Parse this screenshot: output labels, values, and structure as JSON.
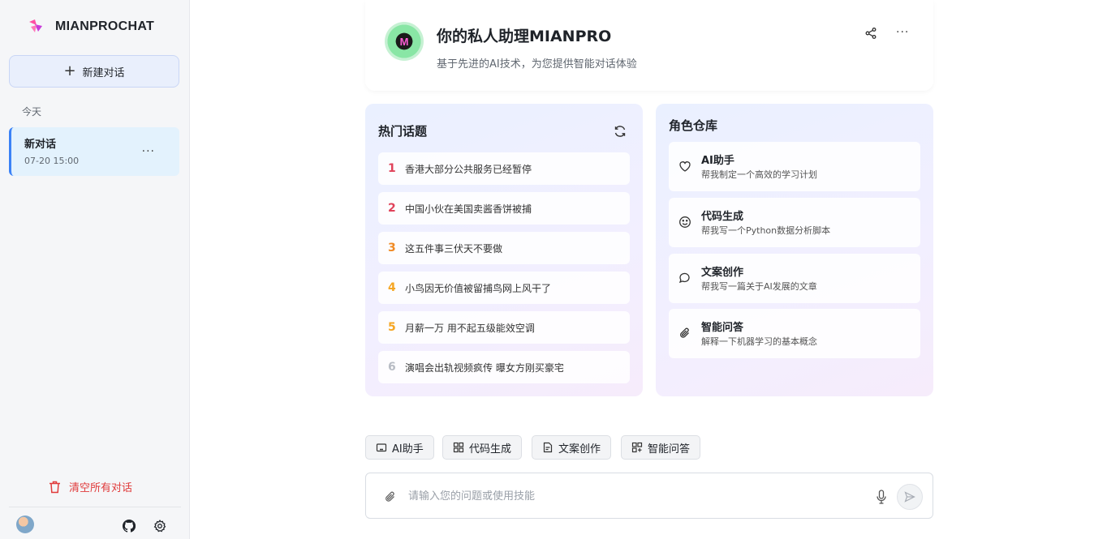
{
  "sidebar": {
    "brand": "MIANPROCHAT",
    "new_chat_label": "新建对话",
    "group_label": "今天",
    "conversations": [
      {
        "title": "新对话",
        "time": "07-20 15:00"
      }
    ],
    "clear_all_label": "清空所有对话"
  },
  "header": {
    "title": "你的私人助理MIANPRO",
    "subtitle": "基于先进的AI技术，为您提供智能对话体验",
    "avatar_letter": "M"
  },
  "hot_topics": {
    "title": "热门话题",
    "items": [
      {
        "rank": "1",
        "text": "香港大部分公共服务已经暂停",
        "color": "#e0425a"
      },
      {
        "rank": "2",
        "text": "中国小伙在美国卖酱香饼被捕",
        "color": "#e0425a"
      },
      {
        "rank": "3",
        "text": "这五件事三伏天不要做",
        "color": "#f08a24"
      },
      {
        "rank": "4",
        "text": "小鸟因无价值被留捕鸟网上风干了",
        "color": "#f5a623"
      },
      {
        "rank": "5",
        "text": "月薪一万 用不起五级能效空调",
        "color": "#f5a623"
      },
      {
        "rank": "6",
        "text": "演唱会出轨视频疯传 曝女方刚买豪宅",
        "color": "#b8bcc4"
      }
    ]
  },
  "roles": {
    "title": "角色仓库",
    "items": [
      {
        "name": "AI助手",
        "desc": "帮我制定一个高效的学习计划",
        "icon": "heart-icon"
      },
      {
        "name": "代码生成",
        "desc": "帮我写一个Python数据分析脚本",
        "icon": "smile-icon"
      },
      {
        "name": "文案创作",
        "desc": "帮我写一篇关于AI发展的文章",
        "icon": "chat-bubble-icon"
      },
      {
        "name": "智能问答",
        "desc": "解释一下机器学习的基本概念",
        "icon": "paperclip-icon"
      }
    ]
  },
  "skills": [
    {
      "label": "AI助手",
      "icon": "robot-icon"
    },
    {
      "label": "代码生成",
      "icon": "grid-icon"
    },
    {
      "label": "文案创作",
      "icon": "document-icon"
    },
    {
      "label": "智能问答",
      "icon": "apps-icon"
    }
  ],
  "input": {
    "placeholder": "请输入您的问题或使用技能",
    "value": ""
  },
  "colors": {
    "accent": "#3b82f6",
    "danger": "#e03b3b"
  }
}
